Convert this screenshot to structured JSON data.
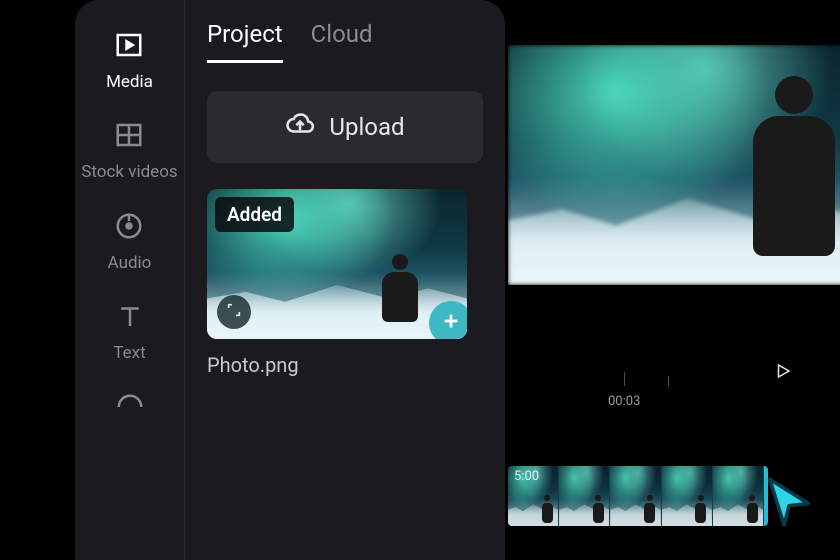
{
  "sidebar": {
    "items": [
      {
        "label": "Media",
        "icon": "media"
      },
      {
        "label": "Stock videos",
        "icon": "stock"
      },
      {
        "label": "Audio",
        "icon": "audio"
      },
      {
        "label": "Text",
        "icon": "text"
      }
    ]
  },
  "panel": {
    "tabs": [
      {
        "label": "Project"
      },
      {
        "label": "Cloud"
      }
    ],
    "upload_label": "Upload",
    "asset": {
      "badge": "Added",
      "filename": "Photo.png"
    }
  },
  "timeline": {
    "tick_label": "00:03",
    "clip_duration": "5:00"
  }
}
